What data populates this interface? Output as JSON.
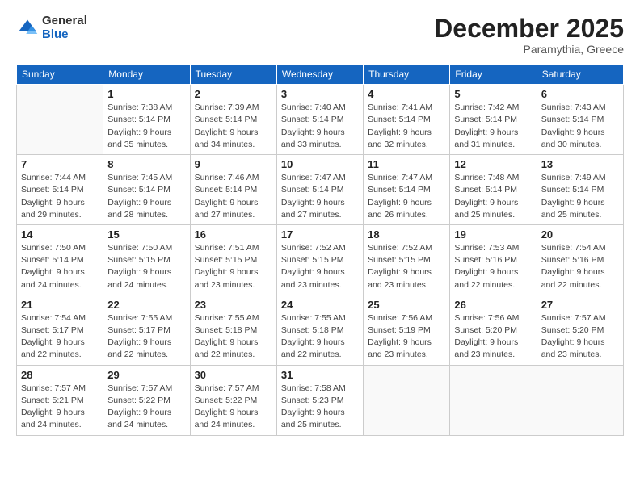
{
  "header": {
    "logo_general": "General",
    "logo_blue": "Blue",
    "month_title": "December 2025",
    "location": "Paramythia, Greece"
  },
  "weekdays": [
    "Sunday",
    "Monday",
    "Tuesday",
    "Wednesday",
    "Thursday",
    "Friday",
    "Saturday"
  ],
  "weeks": [
    [
      {
        "day": "",
        "info": ""
      },
      {
        "day": "1",
        "info": "Sunrise: 7:38 AM\nSunset: 5:14 PM\nDaylight: 9 hours\nand 35 minutes."
      },
      {
        "day": "2",
        "info": "Sunrise: 7:39 AM\nSunset: 5:14 PM\nDaylight: 9 hours\nand 34 minutes."
      },
      {
        "day": "3",
        "info": "Sunrise: 7:40 AM\nSunset: 5:14 PM\nDaylight: 9 hours\nand 33 minutes."
      },
      {
        "day": "4",
        "info": "Sunrise: 7:41 AM\nSunset: 5:14 PM\nDaylight: 9 hours\nand 32 minutes."
      },
      {
        "day": "5",
        "info": "Sunrise: 7:42 AM\nSunset: 5:14 PM\nDaylight: 9 hours\nand 31 minutes."
      },
      {
        "day": "6",
        "info": "Sunrise: 7:43 AM\nSunset: 5:14 PM\nDaylight: 9 hours\nand 30 minutes."
      }
    ],
    [
      {
        "day": "7",
        "info": "Sunrise: 7:44 AM\nSunset: 5:14 PM\nDaylight: 9 hours\nand 29 minutes."
      },
      {
        "day": "8",
        "info": "Sunrise: 7:45 AM\nSunset: 5:14 PM\nDaylight: 9 hours\nand 28 minutes."
      },
      {
        "day": "9",
        "info": "Sunrise: 7:46 AM\nSunset: 5:14 PM\nDaylight: 9 hours\nand 27 minutes."
      },
      {
        "day": "10",
        "info": "Sunrise: 7:47 AM\nSunset: 5:14 PM\nDaylight: 9 hours\nand 27 minutes."
      },
      {
        "day": "11",
        "info": "Sunrise: 7:47 AM\nSunset: 5:14 PM\nDaylight: 9 hours\nand 26 minutes."
      },
      {
        "day": "12",
        "info": "Sunrise: 7:48 AM\nSunset: 5:14 PM\nDaylight: 9 hours\nand 25 minutes."
      },
      {
        "day": "13",
        "info": "Sunrise: 7:49 AM\nSunset: 5:14 PM\nDaylight: 9 hours\nand 25 minutes."
      }
    ],
    [
      {
        "day": "14",
        "info": "Sunrise: 7:50 AM\nSunset: 5:14 PM\nDaylight: 9 hours\nand 24 minutes."
      },
      {
        "day": "15",
        "info": "Sunrise: 7:50 AM\nSunset: 5:15 PM\nDaylight: 9 hours\nand 24 minutes."
      },
      {
        "day": "16",
        "info": "Sunrise: 7:51 AM\nSunset: 5:15 PM\nDaylight: 9 hours\nand 23 minutes."
      },
      {
        "day": "17",
        "info": "Sunrise: 7:52 AM\nSunset: 5:15 PM\nDaylight: 9 hours\nand 23 minutes."
      },
      {
        "day": "18",
        "info": "Sunrise: 7:52 AM\nSunset: 5:15 PM\nDaylight: 9 hours\nand 23 minutes."
      },
      {
        "day": "19",
        "info": "Sunrise: 7:53 AM\nSunset: 5:16 PM\nDaylight: 9 hours\nand 22 minutes."
      },
      {
        "day": "20",
        "info": "Sunrise: 7:54 AM\nSunset: 5:16 PM\nDaylight: 9 hours\nand 22 minutes."
      }
    ],
    [
      {
        "day": "21",
        "info": "Sunrise: 7:54 AM\nSunset: 5:17 PM\nDaylight: 9 hours\nand 22 minutes."
      },
      {
        "day": "22",
        "info": "Sunrise: 7:55 AM\nSunset: 5:17 PM\nDaylight: 9 hours\nand 22 minutes."
      },
      {
        "day": "23",
        "info": "Sunrise: 7:55 AM\nSunset: 5:18 PM\nDaylight: 9 hours\nand 22 minutes."
      },
      {
        "day": "24",
        "info": "Sunrise: 7:55 AM\nSunset: 5:18 PM\nDaylight: 9 hours\nand 22 minutes."
      },
      {
        "day": "25",
        "info": "Sunrise: 7:56 AM\nSunset: 5:19 PM\nDaylight: 9 hours\nand 23 minutes."
      },
      {
        "day": "26",
        "info": "Sunrise: 7:56 AM\nSunset: 5:20 PM\nDaylight: 9 hours\nand 23 minutes."
      },
      {
        "day": "27",
        "info": "Sunrise: 7:57 AM\nSunset: 5:20 PM\nDaylight: 9 hours\nand 23 minutes."
      }
    ],
    [
      {
        "day": "28",
        "info": "Sunrise: 7:57 AM\nSunset: 5:21 PM\nDaylight: 9 hours\nand 24 minutes."
      },
      {
        "day": "29",
        "info": "Sunrise: 7:57 AM\nSunset: 5:22 PM\nDaylight: 9 hours\nand 24 minutes."
      },
      {
        "day": "30",
        "info": "Sunrise: 7:57 AM\nSunset: 5:22 PM\nDaylight: 9 hours\nand 24 minutes."
      },
      {
        "day": "31",
        "info": "Sunrise: 7:58 AM\nSunset: 5:23 PM\nDaylight: 9 hours\nand 25 minutes."
      },
      {
        "day": "",
        "info": ""
      },
      {
        "day": "",
        "info": ""
      },
      {
        "day": "",
        "info": ""
      }
    ]
  ]
}
